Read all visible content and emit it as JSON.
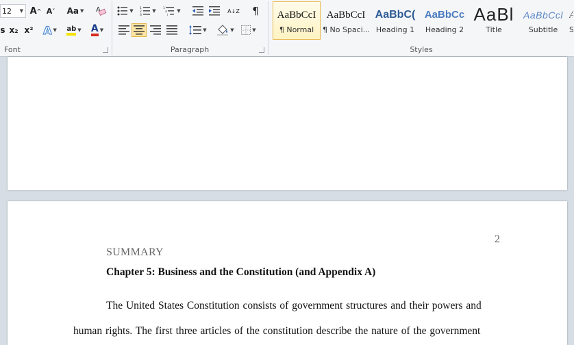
{
  "ribbon": {
    "font_group": {
      "label": "Font",
      "font_size": "12",
      "grow_font": "A",
      "shrink_font": "A",
      "change_case": "Aa",
      "clear_formatting": "A",
      "subscript": "x₂",
      "superscript": "x²",
      "text_effects": "A",
      "highlight": "ab",
      "font_color": "A",
      "highlight_color": "#f4e400",
      "font_color_value": "#d62d20"
    },
    "paragraph_group": {
      "label": "Paragraph",
      "sort": "A↓Z",
      "show_marks": "¶"
    },
    "styles_group": {
      "label": "Styles",
      "items": [
        {
          "sample": "AaBbCcI",
          "name": "¶ Normal"
        },
        {
          "sample": "AaBbCcI",
          "name": "¶ No Spaci..."
        },
        {
          "sample": "AaBbC(",
          "name": "Heading 1"
        },
        {
          "sample": "AaBbCc",
          "name": "Heading 2"
        },
        {
          "sample": "AaBl",
          "name": "Title"
        },
        {
          "sample": "AaBbCcl",
          "name": "Subtitle"
        },
        {
          "sample": "A",
          "name": "Sub"
        }
      ]
    }
  },
  "document": {
    "page_number": "2",
    "summary": "SUMMARY",
    "chapter_heading": "Chapter 5: Business and the Constitution (and Appendix A)",
    "body_line1": "The United States Constitution consists of government structures and their powers and",
    "body_line2": "human rights. The first three articles of the constitution describe the nature of the government"
  }
}
